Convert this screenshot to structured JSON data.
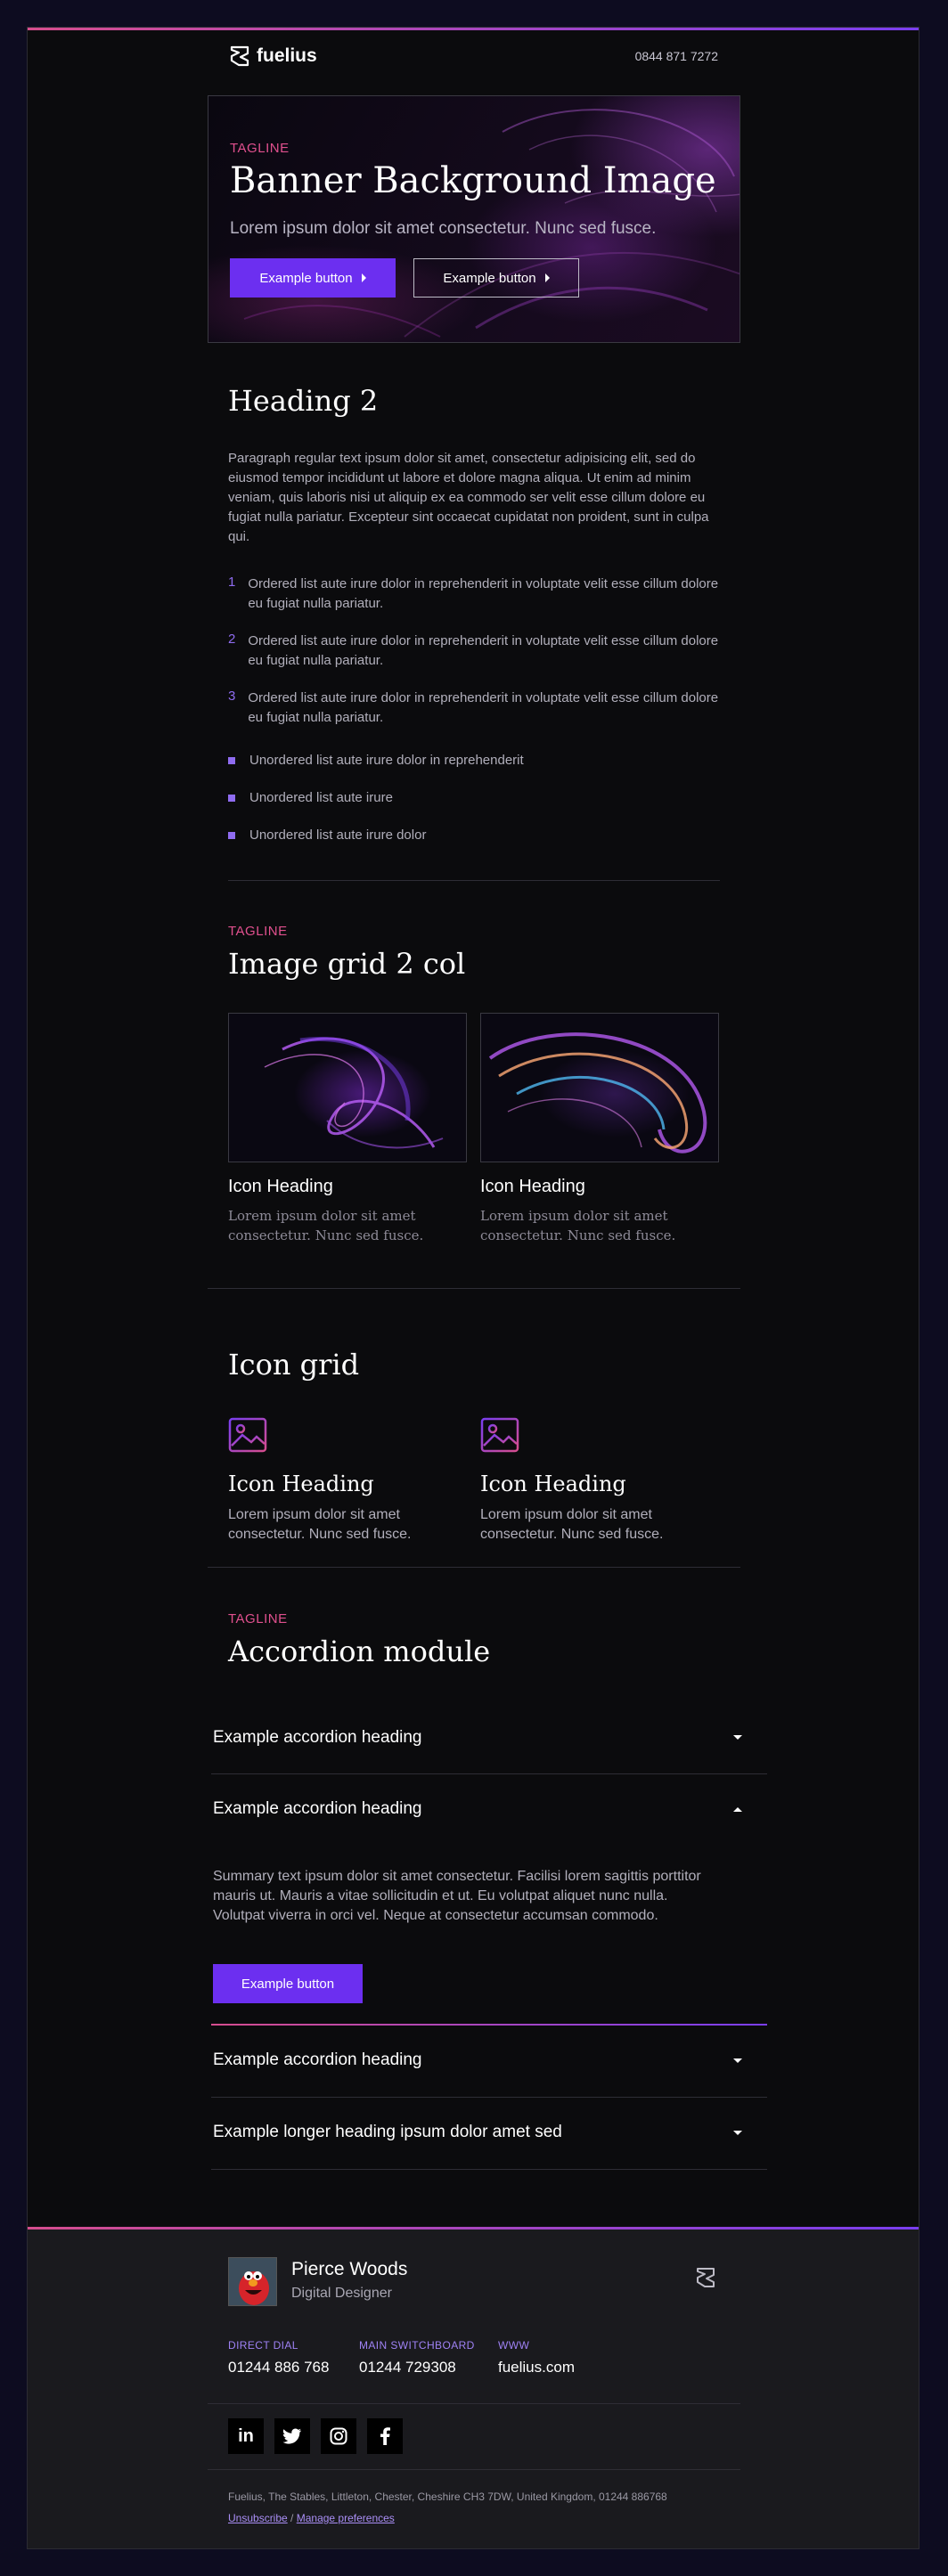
{
  "header": {
    "brand": "fuelius",
    "phone": "0844 871 7272"
  },
  "banner": {
    "tagline": "TAGLINE",
    "title": "Banner Background Image",
    "subtitle": "Lorem ipsum dolor sit amet consectetur. Nunc sed fusce.",
    "primary_button": "Example button",
    "secondary_button": "Example button"
  },
  "content": {
    "heading": "Heading 2",
    "paragraph": "Paragraph regular text ipsum dolor sit amet, consectetur adipisicing elit, sed do eiusmod tempor incididunt ut labore et dolore magna aliqua. Ut enim ad minim veniam, quis laboris nisi ut aliquip ex ea commodo ser velit esse cillum dolore eu fugiat nulla pariatur. Excepteur sint occaecat cupidatat non proident, sunt in culpa qui.",
    "ordered": [
      {
        "num": "1",
        "text": "Ordered list aute irure dolor in reprehenderit in voluptate velit esse cillum dolore eu fugiat nulla pariatur."
      },
      {
        "num": "2",
        "text": "Ordered list aute irure dolor in reprehenderit in voluptate velit esse cillum dolore eu fugiat nulla pariatur."
      },
      {
        "num": "3",
        "text": "Ordered list aute irure dolor in reprehenderit in voluptate velit esse cillum dolore eu fugiat nulla pariatur."
      }
    ],
    "unordered": [
      "Unordered list aute irure dolor in reprehenderit",
      "Unordered list aute irure",
      "Unordered list aute irure dolor"
    ]
  },
  "image_grid": {
    "tagline": "TAGLINE",
    "title": "Image grid 2 col",
    "items": [
      {
        "heading": "Icon Heading",
        "text": "Lorem ipsum dolor sit amet consectetur. Nunc sed fusce."
      },
      {
        "heading": "Icon Heading",
        "text": "Lorem ipsum dolor sit amet consectetur. Nunc sed fusce."
      }
    ]
  },
  "icon_grid": {
    "title": "Icon grid",
    "items": [
      {
        "icon": "image-icon",
        "heading": "Icon Heading",
        "text": "Lorem ipsum dolor sit amet consectetur. Nunc sed fusce."
      },
      {
        "icon": "image-icon",
        "heading": "Icon Heading",
        "text": "Lorem ipsum dolor sit amet consectetur. Nunc sed fusce."
      }
    ]
  },
  "accordion": {
    "tagline": "TAGLINE",
    "title": "Accordion module",
    "items": [
      {
        "heading": "Example accordion heading",
        "open": false
      },
      {
        "heading": "Example accordion heading",
        "open": true,
        "body": "Summary text ipsum dolor sit amet consectetur. Facilisi lorem sagittis porttitor mauris ut. Mauris a vitae sollicitudin et ut. Eu volutpat aliquet nunc nulla. Volutpat viverra in orci vel. Neque at consectetur accumsan commodo.",
        "button": "Example button"
      },
      {
        "heading": "Example accordion heading",
        "open": false
      },
      {
        "heading": "Example longer heading ipsum dolor amet sed",
        "open": false
      }
    ]
  },
  "footer": {
    "name": "Pierce Woods",
    "role": "Digital Designer",
    "contacts": [
      {
        "label": "DIRECT DIAL",
        "value": "01244 886 768"
      },
      {
        "label": "MAIN SWITCHBOARD",
        "value": "01244 729308"
      },
      {
        "label": "WWW",
        "value": "fuelius.com"
      }
    ],
    "social": [
      "linkedin-icon",
      "twitter-icon",
      "instagram-icon",
      "facebook-icon"
    ],
    "address": "Fuelius, The Stables, Littleton, Chester, Cheshire CH3 7DW, United Kingdom, 01244 886768",
    "unsubscribe": "Unsubscribe",
    "separator": "/",
    "manage": "Manage preferences"
  },
  "colors": {
    "accent": "#6c2ff0",
    "tagline": "#e0508e",
    "background": "#0b0b0d",
    "page": "#0d0c20"
  }
}
